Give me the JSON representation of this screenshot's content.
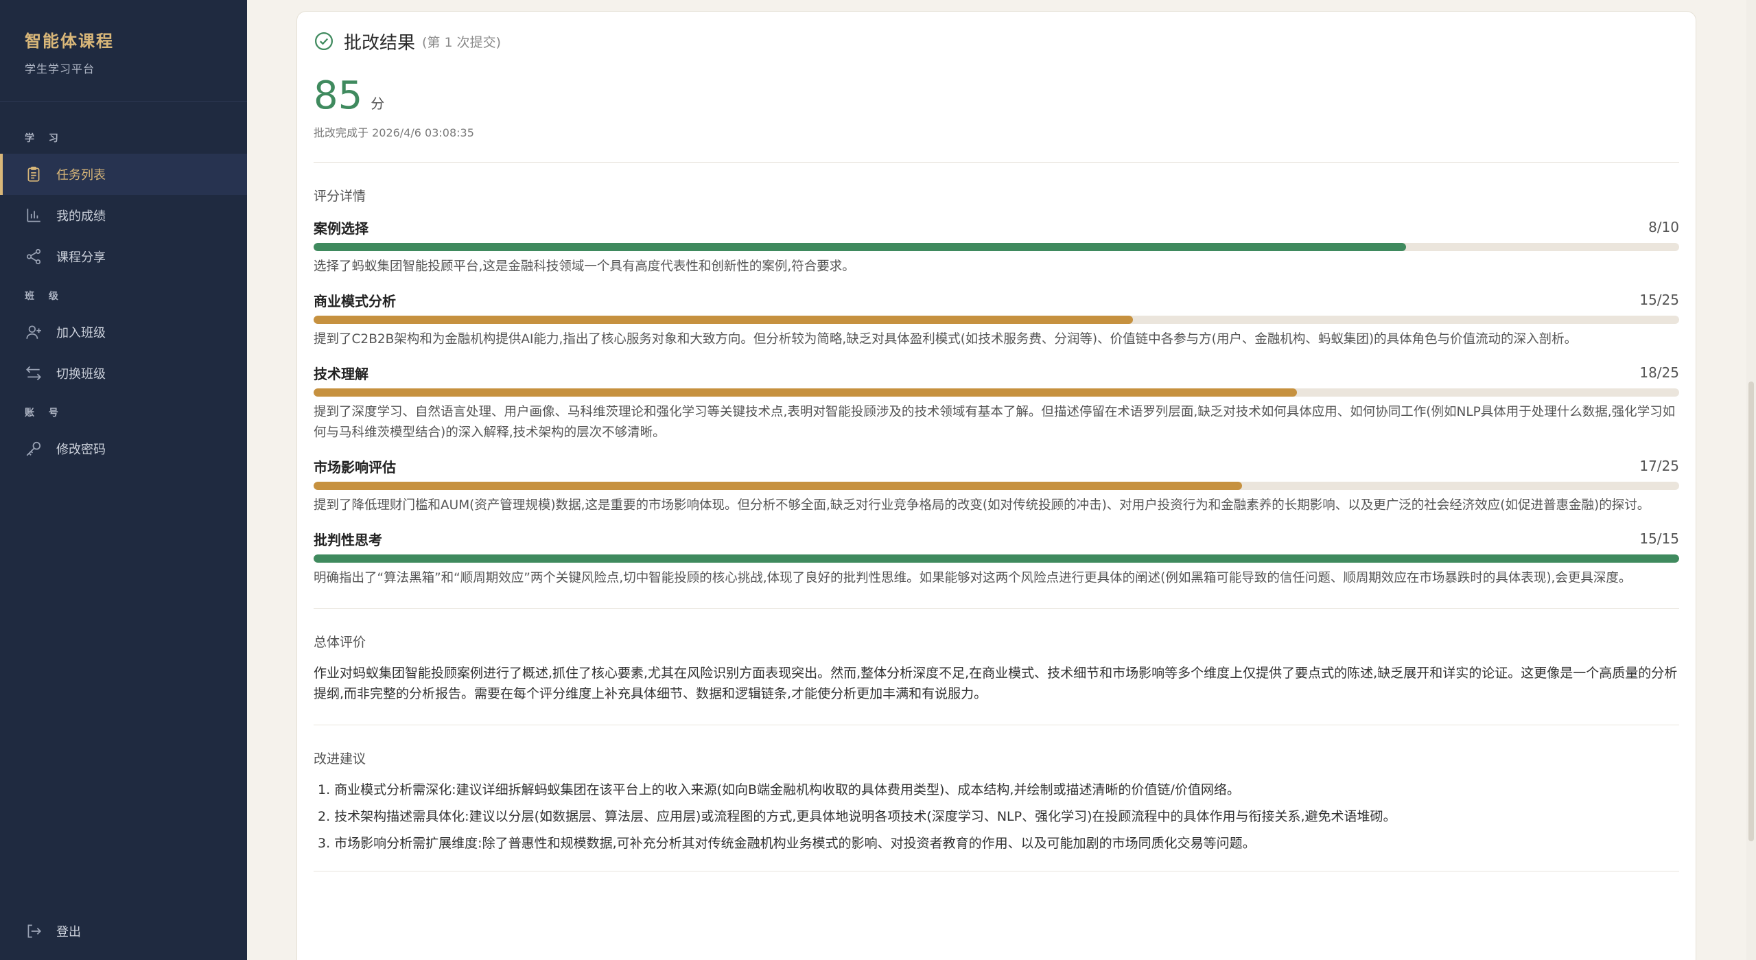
{
  "sidebar": {
    "brand_title": "智能体课程",
    "brand_sub": "学生学习平台",
    "sections": {
      "study": "学 习",
      "class": "班 级",
      "account": "账 号"
    },
    "items": {
      "tasks": "任务列表",
      "grades": "我的成绩",
      "share": "课程分享",
      "join": "加入班级",
      "switch": "切换班级",
      "password": "修改密码"
    },
    "logout": "登出",
    "accent": "#d9b779"
  },
  "result": {
    "title": "批改结果",
    "note": "(第 1 次提交)",
    "score": "85",
    "unit": "分",
    "completed": "批改完成于 2026/4/6 03:08:35"
  },
  "details": {
    "title": "评分详情",
    "criteria": [
      {
        "name": "案例选择",
        "score": "8/10",
        "fraction": 0.8,
        "color": "#3f8a5e",
        "desc": "选择了蚂蚁集团智能投顾平台,这是金融科技领域一个具有高度代表性和创新性的案例,符合要求。"
      },
      {
        "name": "商业模式分析",
        "score": "15/25",
        "fraction": 0.6,
        "color": "#c6913f",
        "desc": "提到了C2B2B架构和为金融机构提供AI能力,指出了核心服务对象和大致方向。但分析较为简略,缺乏对具体盈利模式(如技术服务费、分润等)、价值链中各参与方(用户、金融机构、蚂蚁集团)的具体角色与价值流动的深入剖析。"
      },
      {
        "name": "技术理解",
        "score": "18/25",
        "fraction": 0.72,
        "color": "#c6913f",
        "desc": "提到了深度学习、自然语言处理、用户画像、马科维茨理论和强化学习等关键技术点,表明对智能投顾涉及的技术领域有基本了解。但描述停留在术语罗列层面,缺乏对技术如何具体应用、如何协同工作(例如NLP具体用于处理什么数据,强化学习如何与马科维茨模型结合)的深入解释,技术架构的层次不够清晰。"
      },
      {
        "name": "市场影响评估",
        "score": "17/25",
        "fraction": 0.68,
        "color": "#c6913f",
        "desc": "提到了降低理财门槛和AUM(资产管理规模)数据,这是重要的市场影响体现。但分析不够全面,缺乏对行业竞争格局的改变(如对传统投顾的冲击)、对用户投资行为和金融素养的长期影响、以及更广泛的社会经济效应(如促进普惠金融)的探讨。"
      },
      {
        "name": "批判性思考",
        "score": "15/15",
        "fraction": 1.0,
        "color": "#3f8a5e",
        "desc": "明确指出了“算法黑箱”和“顺周期效应”两个关键风险点,切中智能投顾的核心挑战,体现了良好的批判性思维。如果能够对这两个风险点进行更具体的阐述(例如黑箱可能导致的信任问题、顺周期效应在市场暴跌时的具体表现),会更具深度。"
      }
    ]
  },
  "overall": {
    "title": "总体评价",
    "text": "作业对蚂蚁集团智能投顾案例进行了概述,抓住了核心要素,尤其在风险识别方面表现突出。然而,整体分析深度不足,在商业模式、技术细节和市场影响等多个维度上仅提供了要点式的陈述,缺乏展开和详实的论证。这更像是一个高质量的分析提纲,而非完整的分析报告。需要在每个评分维度上补充具体细节、数据和逻辑链条,才能使分析更加丰满和有说服力。"
  },
  "suggestions": {
    "title": "改进建议",
    "items": [
      "1. 商业模式分析需深化:建议详细拆解蚂蚁集团在该平台上的收入来源(如向B端金融机构收取的具体费用类型)、成本结构,并绘制或描述清晰的价值链/价值网络。",
      "2. 技术架构描述需具体化:建议以分层(如数据层、算法层、应用层)或流程图的方式,更具体地说明各项技术(深度学习、NLP、强化学习)在投顾流程中的具体作用与衔接关系,避免术语堆砌。",
      "3. 市场影响分析需扩展维度:除了普惠性和规模数据,可补充分析其对传统金融机构业务模式的影响、对投资者教育的作用、以及可能加剧的市场同质化交易等问题。"
    ]
  }
}
